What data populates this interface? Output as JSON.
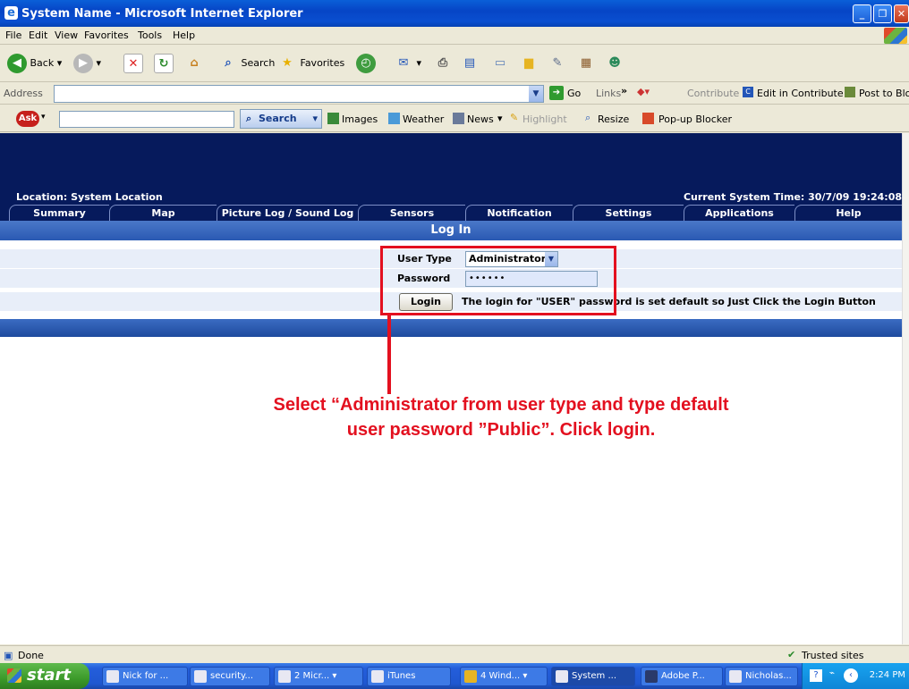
{
  "window": {
    "title": "System Name - Microsoft Internet Explorer"
  },
  "menu": [
    "File",
    "Edit",
    "View",
    "Favorites",
    "Tools",
    "Help"
  ],
  "toolbar": {
    "back": "Back",
    "search": "Search",
    "favorites": "Favorites"
  },
  "address": {
    "label": "Address",
    "value": "",
    "go": "Go",
    "links": "Links",
    "contribute": "Contribute",
    "edit_contribute": "Edit in Contribute",
    "post_blog": "Post to Blog"
  },
  "askbar": {
    "search": "Search",
    "images": "Images",
    "weather": "Weather",
    "news": "News",
    "highlight": "Highlight",
    "resize": "Resize",
    "popup": "Pop-up Blocker"
  },
  "page": {
    "location": "Location: System Location",
    "time": "Current System Time: 30/7/09 19:24:08",
    "tabs": [
      "Summary",
      "Map",
      "Picture Log / Sound Log",
      "Sensors",
      "Notification",
      "Settings",
      "Applications",
      "Help"
    ],
    "login_header": "Log In",
    "user_type_label": "User Type",
    "user_type_value": "Administrator",
    "password_label": "Password",
    "password_mask": "••••••",
    "login_button": "Login",
    "hint": "The login for \"USER\" password is set default so Just Click the Login Button"
  },
  "annotation": {
    "line1": "Select “Administrator from user type and type default",
    "line2": "user password ”Public”. Click login.",
    "color": "#e3101f"
  },
  "status": {
    "done": "Done",
    "zone": "Trusted sites"
  },
  "taskbar": {
    "start": "start",
    "tasks": [
      "Nick for ...",
      "security...",
      "2 Micr...",
      "iTunes",
      "4 Wind...",
      "System ...",
      "Adobe P...",
      "Nicholas..."
    ],
    "clock": "2:24 PM"
  }
}
